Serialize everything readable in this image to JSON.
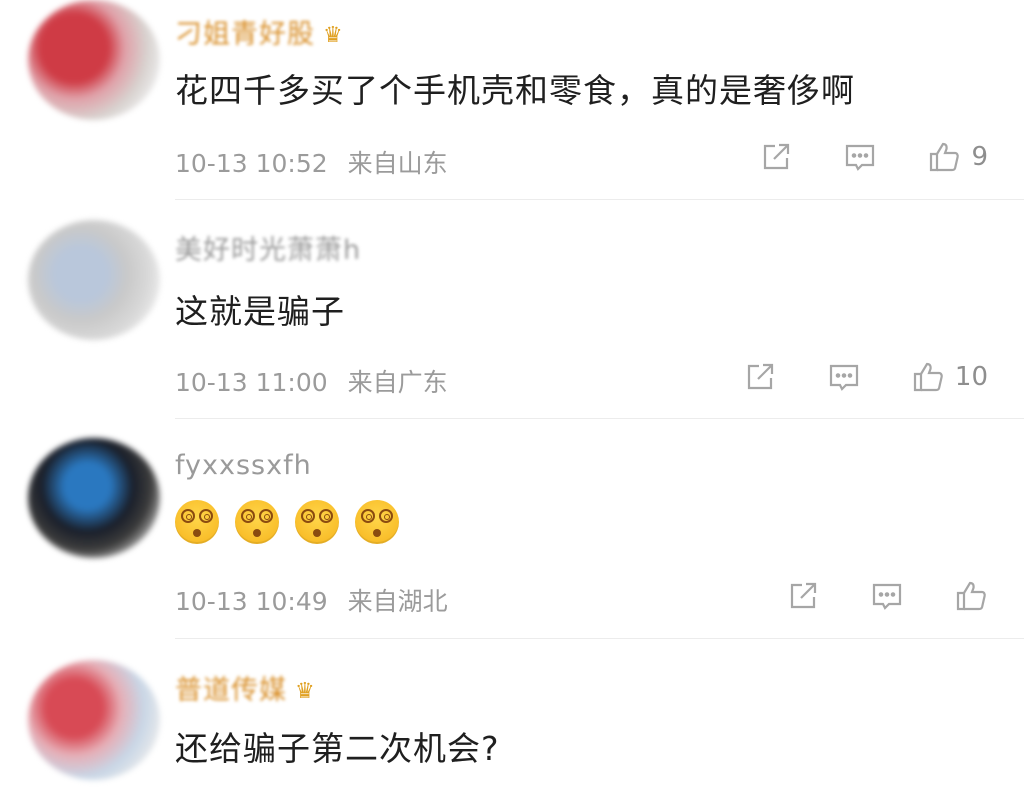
{
  "comments": [
    {
      "username": "刁姐青好股",
      "username_has_crown": true,
      "text": "花四千多买了个手机壳和零食，真的是奢侈啊",
      "date": "10-13 10:52",
      "location": "来自山东",
      "likes": "9"
    },
    {
      "username": "美好时光萧萧h",
      "username_has_crown": false,
      "text": "这就是骗子",
      "date": "10-13 11:00",
      "location": "来自广东",
      "likes": "10"
    },
    {
      "username": "fyxxssxfh",
      "username_has_crown": false,
      "emoji": [
        "dizzy-face",
        "dizzy-face",
        "dizzy-face",
        "dizzy-face"
      ],
      "date": "10-13 10:49",
      "location": "来自湖北",
      "likes": ""
    },
    {
      "username": "普道传媒",
      "username_has_crown": true,
      "text": "还给骗子第二次机会?"
    }
  ],
  "icons": {
    "share": "share-icon",
    "comment": "comment-icon",
    "like": "thumbs-up-icon",
    "crown": "crown-icon"
  },
  "colors": {
    "gold_username": "#d9902b",
    "gray_username": "#9a9a9a",
    "meta": "#9b9b9b",
    "text": "#1f1f1f"
  }
}
